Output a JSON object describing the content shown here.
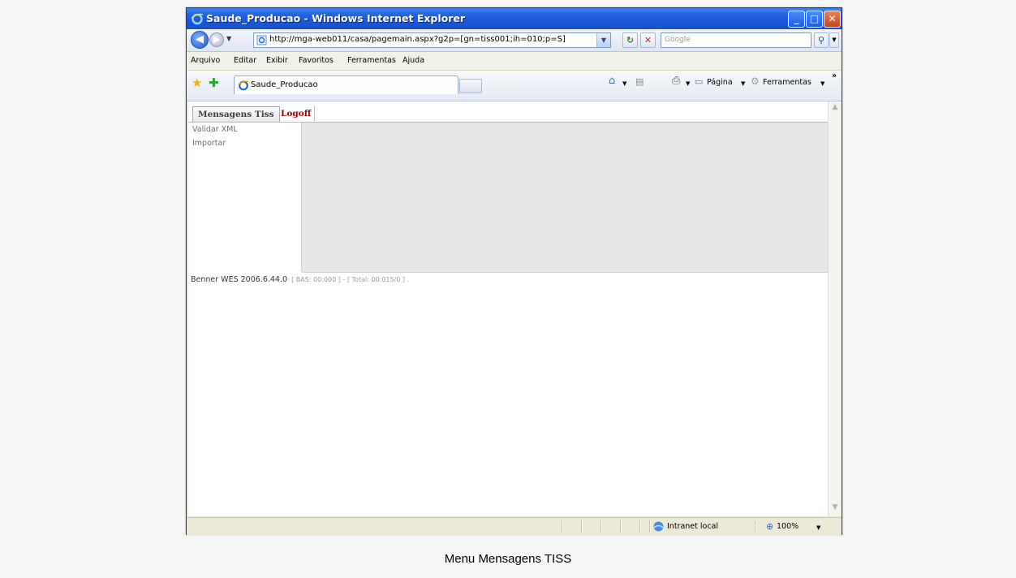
{
  "window": {
    "title": "Saude_Producao - Windows Internet Explorer",
    "minimize_glyph": "_",
    "maximize_glyph": "□",
    "close_glyph": "✕"
  },
  "address_bar": {
    "back_glyph": "◀",
    "forward_glyph": "▶",
    "dropdown_glyph": "▼",
    "url": "http://mga-web011/casa/pagemain.aspx?g2p=[gn=tiss001;ih=010;p=S]",
    "refresh_glyph": "↻",
    "stop_glyph": "✕",
    "search_placeholder": "Google",
    "search_glyph": "⚲"
  },
  "menu": {
    "items": [
      "Arquivo",
      "Editar",
      "Exibir",
      "Favoritos",
      "Ferramentas",
      "Ajuda"
    ]
  },
  "favorites_bar": {
    "tab_title": "Saude_Producao",
    "home_glyph": "⌂",
    "feeds_glyph": "▤",
    "print_glyph": "⎙",
    "page_label": "Página",
    "tools_label": "Ferramentas",
    "chevron_glyph": "»"
  },
  "app": {
    "tabs": {
      "active": "Mensagens Tiss",
      "logoff": "Logoff"
    },
    "left_menu": [
      "Validar XML",
      "Importar"
    ],
    "footer": {
      "version": "Benner WES 2006.6.44.0",
      "timing": "· [ BAS: 00:000 ] - [ Total: 00:015/0 ] ."
    }
  },
  "status_bar": {
    "zone": "Intranet local",
    "zoom": "100%"
  },
  "caption": "Menu Mensagens TISS",
  "colors": {
    "titlebar": "#1c57d9",
    "logoff": "#a00000",
    "work_area": "#e6e6e6"
  }
}
